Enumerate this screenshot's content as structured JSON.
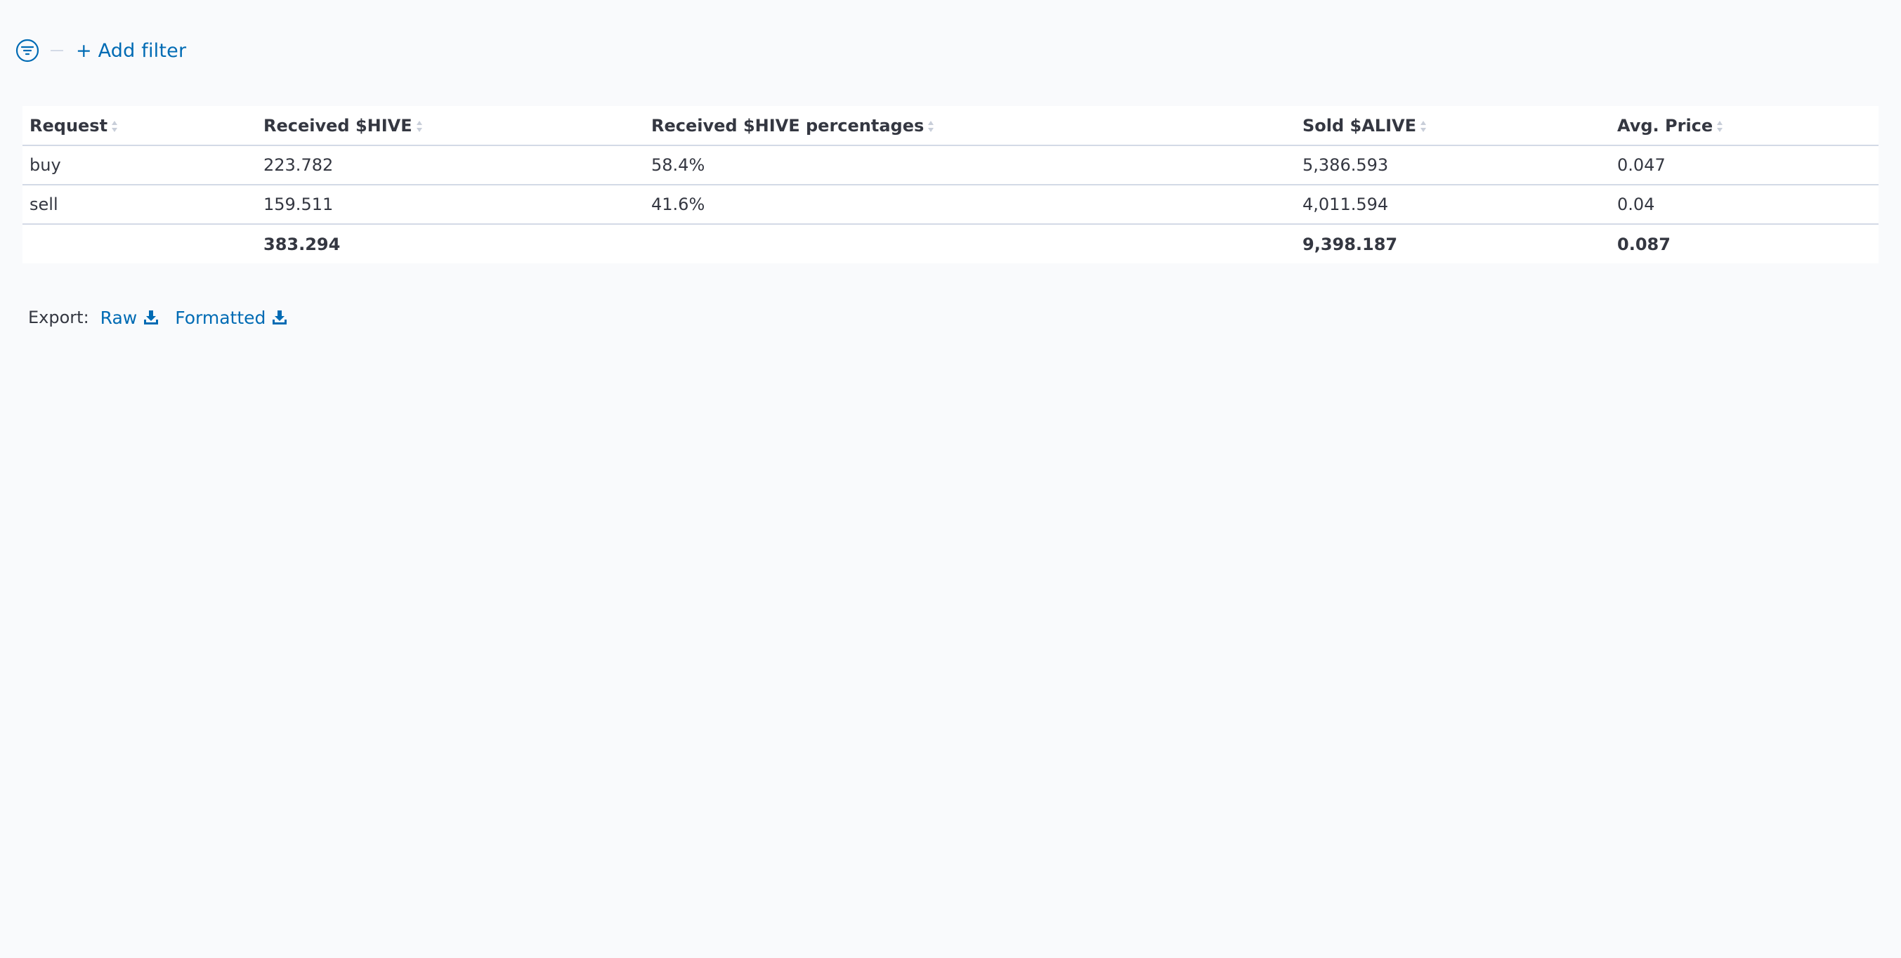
{
  "filter_bar": {
    "add_filter_label": "+ Add filter"
  },
  "table": {
    "columns": [
      "Request",
      "Received $HIVE",
      "Received $HIVE percentages",
      "Sold $ALIVE",
      "Avg. Price"
    ],
    "rows": [
      [
        "buy",
        "223.782",
        "58.4%",
        "5,386.593",
        "0.047"
      ],
      [
        "sell",
        "159.511",
        "41.6%",
        "4,011.594",
        "0.04"
      ]
    ],
    "totals": [
      "",
      "383.294",
      "",
      "9,398.187",
      "0.087"
    ]
  },
  "export": {
    "label": "Export:",
    "raw_label": "Raw",
    "formatted_label": "Formatted"
  },
  "colors": {
    "link": "#006bb4",
    "text": "#343741",
    "border": "#d3dae6",
    "background": "#f9fafc"
  },
  "icons": {
    "filter": "filter-icon",
    "sort": "sort-icon",
    "download": "download-icon"
  }
}
